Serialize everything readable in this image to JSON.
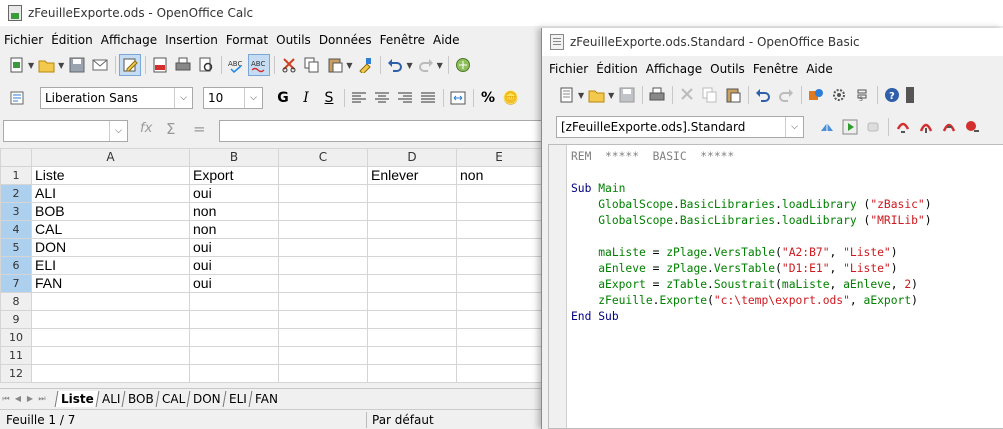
{
  "calc": {
    "title": "zFeuilleExporte.ods - OpenOffice Calc",
    "menu": [
      "Fichier",
      "Édition",
      "Affichage",
      "Insertion",
      "Format",
      "Outils",
      "Données",
      "Fenêtre",
      "Aide"
    ],
    "font_name": "Liberation Sans",
    "font_size": "10",
    "formula_glyphs": {
      "fx": "fx",
      "sum": "Σ",
      "eq": "="
    },
    "columns": [
      "A",
      "B",
      "C",
      "D",
      "E"
    ],
    "rows": [
      {
        "num": "1",
        "a": "Liste",
        "b": "Export",
        "c": "",
        "d": "Enlever",
        "e": "non",
        "sel": false
      },
      {
        "num": "2",
        "a": "ALI",
        "b": "oui",
        "c": "",
        "d": "",
        "e": "",
        "sel": true
      },
      {
        "num": "3",
        "a": "BOB",
        "b": "non",
        "c": "",
        "d": "",
        "e": "",
        "sel": true
      },
      {
        "num": "4",
        "a": "CAL",
        "b": "non",
        "c": "",
        "d": "",
        "e": "",
        "sel": true
      },
      {
        "num": "5",
        "a": "DON",
        "b": "oui",
        "c": "",
        "d": "",
        "e": "",
        "sel": true
      },
      {
        "num": "6",
        "a": "ELI",
        "b": "oui",
        "c": "",
        "d": "",
        "e": "",
        "sel": true
      },
      {
        "num": "7",
        "a": "FAN",
        "b": "oui",
        "c": "",
        "d": "",
        "e": "",
        "sel": true
      },
      {
        "num": "8",
        "a": "",
        "b": "",
        "c": "",
        "d": "",
        "e": "",
        "sel": false
      },
      {
        "num": "9",
        "a": "",
        "b": "",
        "c": "",
        "d": "",
        "e": "",
        "sel": false
      },
      {
        "num": "10",
        "a": "",
        "b": "",
        "c": "",
        "d": "",
        "e": "",
        "sel": false
      },
      {
        "num": "11",
        "a": "",
        "b": "",
        "c": "",
        "d": "",
        "e": "",
        "sel": false
      },
      {
        "num": "12",
        "a": "",
        "b": "",
        "c": "",
        "d": "",
        "e": "",
        "sel": false
      }
    ],
    "sheet_tabs": [
      "Liste",
      "ALI",
      "BOB",
      "CAL",
      "DON",
      "ELI",
      "FAN"
    ],
    "active_tab": "Liste",
    "status_sheet": "Feuille 1 / 7",
    "status_style": "Par défaut"
  },
  "basic": {
    "title": "zFeuilleExporte.ods.Standard - OpenOffice Basic",
    "menu": [
      "Fichier",
      "Édition",
      "Affichage",
      "Outils",
      "Fenêtre",
      "Aide"
    ],
    "library": "[zFeuilleExporte.ods].Standard",
    "code": [
      [
        [
          "cm",
          "REM  *****  BASIC  *****"
        ]
      ],
      [],
      [
        [
          "kw",
          "Sub"
        ],
        [
          "pl",
          " "
        ],
        [
          "id",
          "Main"
        ]
      ],
      [
        [
          "pl",
          "    "
        ],
        [
          "id",
          "GlobalScope"
        ],
        [
          "pl",
          "."
        ],
        [
          "id",
          "BasicLibraries"
        ],
        [
          "pl",
          "."
        ],
        [
          "id",
          "loadLibrary"
        ],
        [
          "pl",
          " ("
        ],
        [
          "st",
          "\"zBasic\""
        ],
        [
          "pl",
          ")"
        ]
      ],
      [
        [
          "pl",
          "    "
        ],
        [
          "id",
          "GlobalScope"
        ],
        [
          "pl",
          "."
        ],
        [
          "id",
          "BasicLibraries"
        ],
        [
          "pl",
          "."
        ],
        [
          "id",
          "loadLibrary"
        ],
        [
          "pl",
          " ("
        ],
        [
          "st",
          "\"MRILib\""
        ],
        [
          "pl",
          ")"
        ]
      ],
      [],
      [
        [
          "pl",
          "    "
        ],
        [
          "id",
          "maListe"
        ],
        [
          "pl",
          " = "
        ],
        [
          "id",
          "zPlage"
        ],
        [
          "pl",
          "."
        ],
        [
          "id",
          "VersTable"
        ],
        [
          "pl",
          "("
        ],
        [
          "st",
          "\"A2:B7\""
        ],
        [
          "pl",
          ", "
        ],
        [
          "st",
          "\"Liste\""
        ],
        [
          "pl",
          ")"
        ]
      ],
      [
        [
          "pl",
          "    "
        ],
        [
          "id",
          "aEnleve"
        ],
        [
          "pl",
          " = "
        ],
        [
          "id",
          "zPlage"
        ],
        [
          "pl",
          "."
        ],
        [
          "id",
          "VersTable"
        ],
        [
          "pl",
          "("
        ],
        [
          "st",
          "\"D1:E1\""
        ],
        [
          "pl",
          ", "
        ],
        [
          "st",
          "\"Liste\""
        ],
        [
          "pl",
          ")"
        ]
      ],
      [
        [
          "pl",
          "    "
        ],
        [
          "id",
          "aExport"
        ],
        [
          "pl",
          " = "
        ],
        [
          "id",
          "zTable"
        ],
        [
          "pl",
          "."
        ],
        [
          "id",
          "Soustrait"
        ],
        [
          "pl",
          "("
        ],
        [
          "id",
          "maListe"
        ],
        [
          "pl",
          ", "
        ],
        [
          "id",
          "aEnleve"
        ],
        [
          "pl",
          ", "
        ],
        [
          "st",
          "2"
        ],
        [
          "pl",
          ")"
        ]
      ],
      [
        [
          "pl",
          "    "
        ],
        [
          "id",
          "zFeuille"
        ],
        [
          "pl",
          "."
        ],
        [
          "id",
          "Exporte"
        ],
        [
          "pl",
          "("
        ],
        [
          "st",
          "\"c:\\temp\\export.ods\""
        ],
        [
          "pl",
          ", "
        ],
        [
          "id",
          "aExport"
        ],
        [
          "pl",
          ")"
        ]
      ],
      [
        [
          "kw",
          "End"
        ],
        [
          "pl",
          " "
        ],
        [
          "kw",
          "Sub"
        ]
      ]
    ]
  },
  "colors": {
    "selection": "#aed0ef",
    "keyword": "#000080",
    "identifier": "#008000",
    "string": "#ce181e",
    "comment": "#808080"
  }
}
